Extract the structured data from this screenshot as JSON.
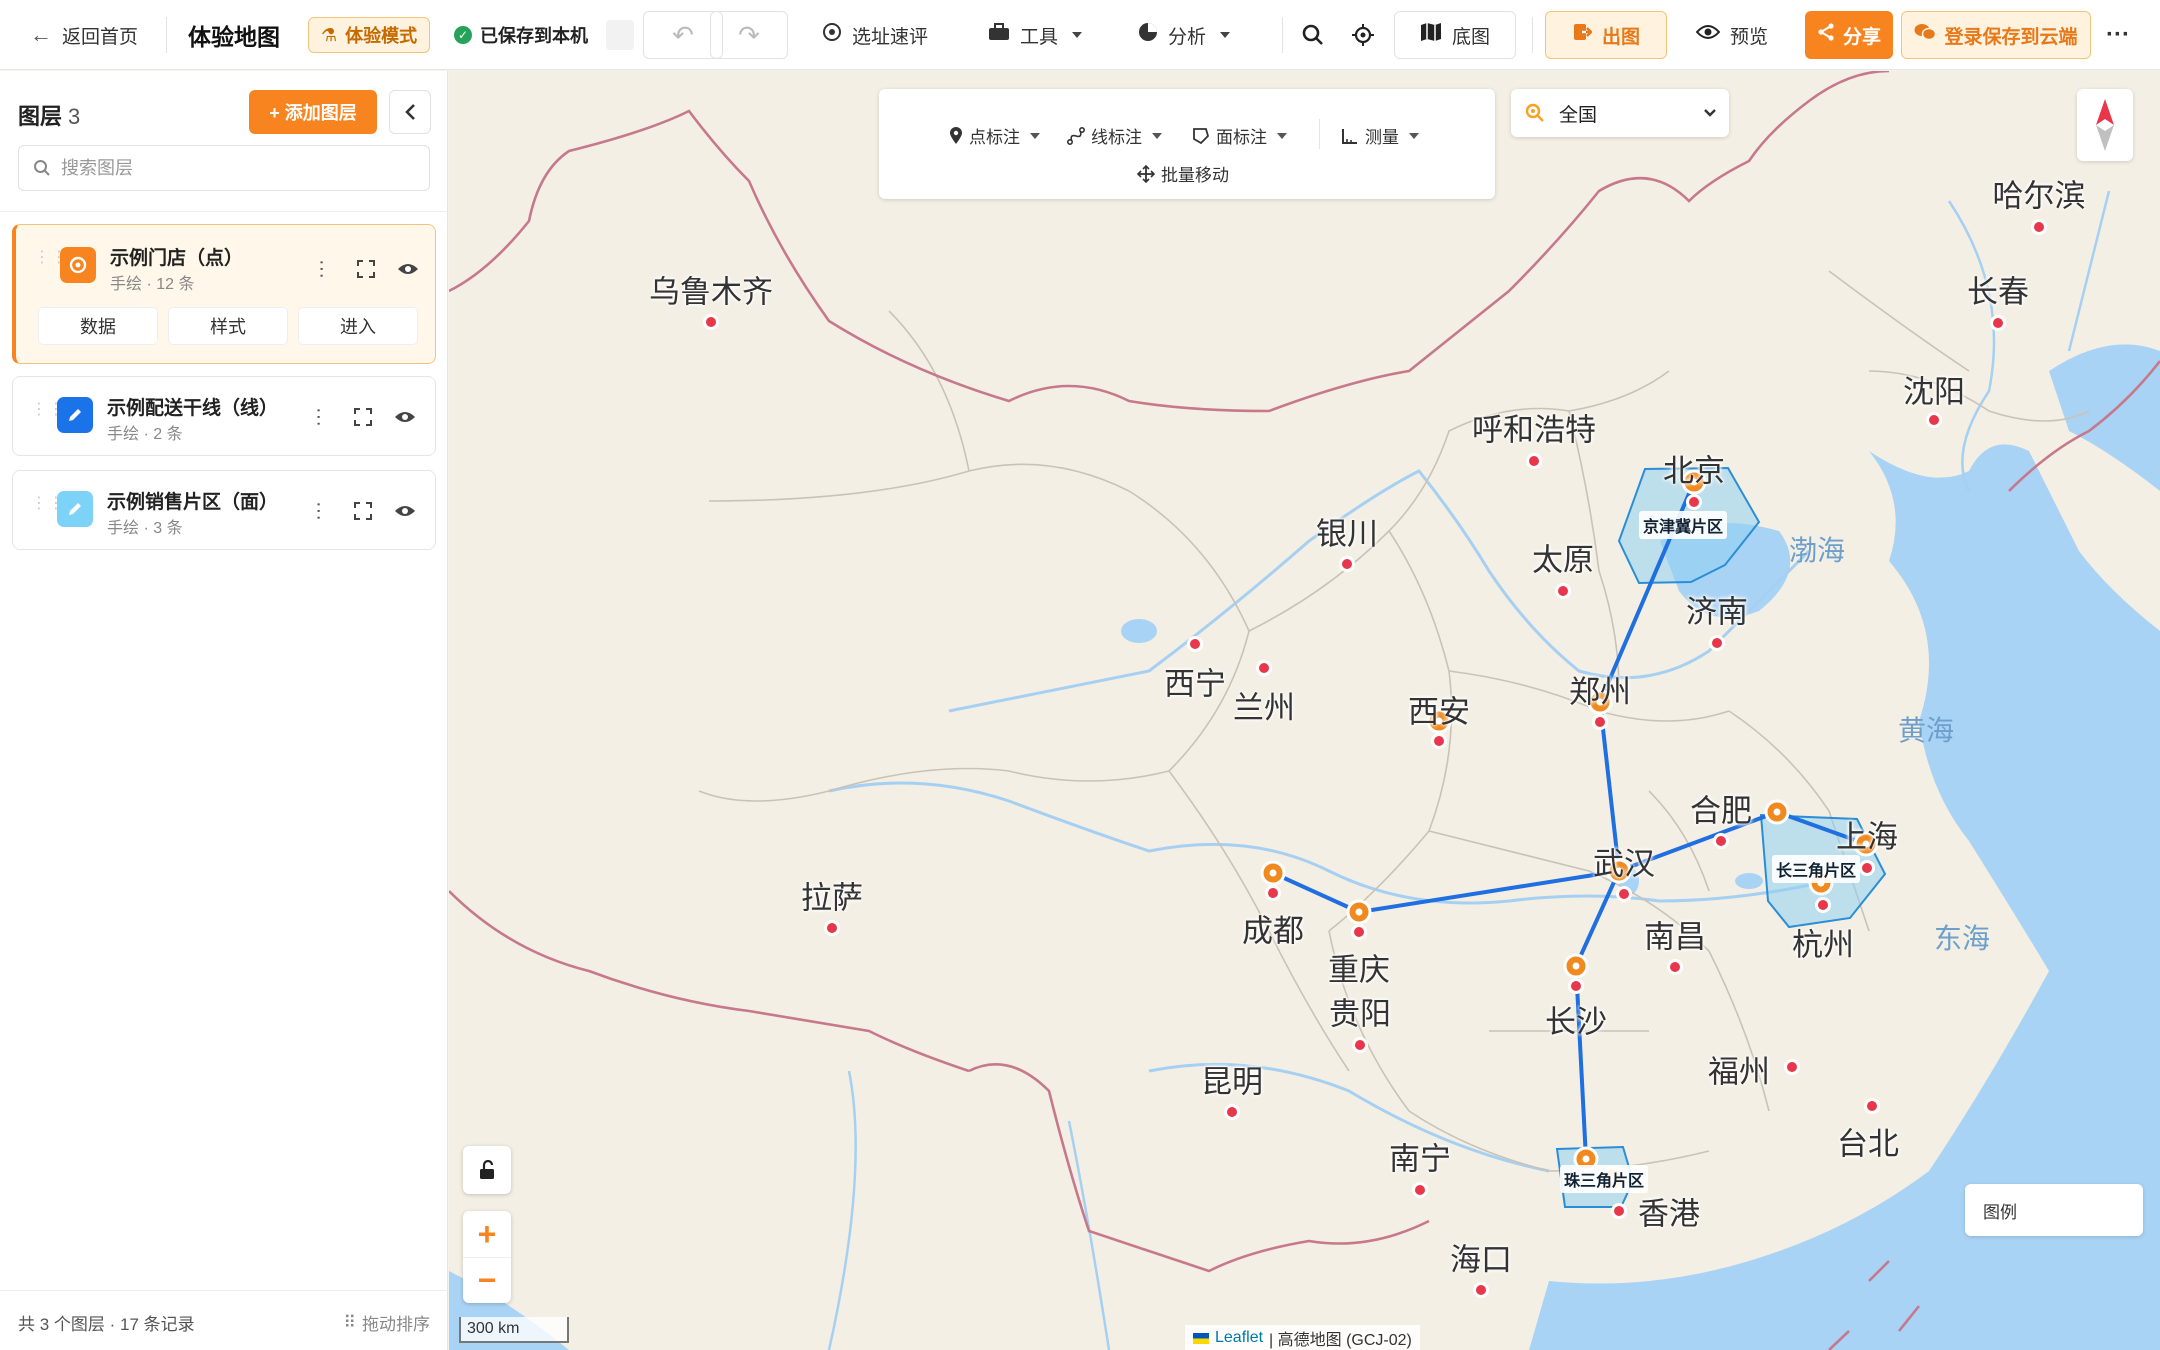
{
  "topbar": {
    "back_label": "返回首页",
    "map_title": "体验地图",
    "mode_badge": "体验模式",
    "saved_status": "已保存到本机",
    "site_eval": "选址速评",
    "tools": "工具",
    "analysis": "分析",
    "basemap": "底图",
    "export": "出图",
    "preview": "预览",
    "share": "分享",
    "login_save": "登录保存到云端"
  },
  "sidebar": {
    "title": "图层",
    "count": "3",
    "add_layer": "+ 添加图层",
    "search_placeholder": "搜索图层",
    "layers": [
      {
        "name": "示例门店（点）",
        "sub": "手绘 · 12 条",
        "tabs": [
          "数据",
          "样式",
          "进入"
        ]
      },
      {
        "name": "示例配送干线（线）",
        "sub": "手绘 · 2 条"
      },
      {
        "name": "示例销售片区（面）",
        "sub": "手绘 · 3 条"
      }
    ],
    "footer_summary": "共 3 个图层 · 17 条记录",
    "footer_sort": "拖动排序"
  },
  "map": {
    "tools": {
      "point": "点标注",
      "line": "线标注",
      "area": "面标注",
      "measure": "测量",
      "batch_move": "批量移动"
    },
    "region": "全国",
    "legend_title": "图例",
    "scale": "300 km",
    "attribution_leaflet": "Leaflet",
    "attribution_source": "| 高德地图 (GCJ-02)",
    "cities": [
      "乌鲁木齐",
      "哈尔滨",
      "长春",
      "沈阳",
      "呼和浩特",
      "北京",
      "银川",
      "太原",
      "济南",
      "西宁",
      "兰州",
      "西安",
      "郑州",
      "合肥",
      "上海",
      "武汉",
      "拉萨",
      "成都",
      "重庆",
      "南昌",
      "杭州",
      "贵阳",
      "长沙",
      "福州",
      "昆明",
      "台北",
      "南宁",
      "香港",
      "海口"
    ],
    "seas": [
      "渤海",
      "黄海",
      "东海"
    ],
    "regions": [
      "京津冀片区",
      "长三角片区",
      "珠三角片区"
    ]
  },
  "colors": {
    "accent": "#f7841f",
    "route": "#1f6fe0",
    "area_fill": "#8fd0f0",
    "marker": "#f08a1e"
  }
}
